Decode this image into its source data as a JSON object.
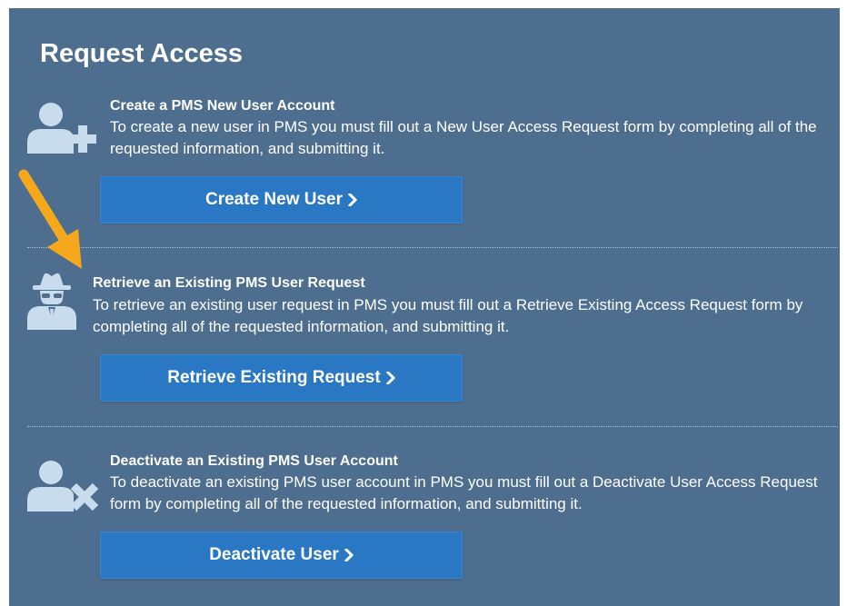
{
  "page": {
    "title": "Request Access"
  },
  "sections": [
    {
      "icon": "user-add-icon",
      "heading": "Create a PMS New User Account",
      "description": "To create a new user in PMS you must fill out a New User Access Request form by completing all of the requested information, and submitting it.",
      "button_label": "Create New User"
    },
    {
      "icon": "spy-user-icon",
      "heading": "Retrieve an Existing PMS User Request",
      "description": "To retrieve an existing user request in PMS you must fill out a Retrieve Existing Access Request form by completing all of the requested information, and submitting it.",
      "button_label": "Retrieve Existing Request"
    },
    {
      "icon": "user-remove-icon",
      "heading": "Deactivate an Existing PMS User Account",
      "description": "To deactivate an existing PMS user account in PMS you must fill out a Deactivate User Access Request form by completing all of the requested information, and submitting it.",
      "button_label": "Deactivate User"
    }
  ],
  "annotation": {
    "icon": "pointer-arrow-icon",
    "color": "#f5a81c"
  },
  "colors": {
    "panel_background": "#4d6e8f",
    "button_background": "#2a77c3",
    "icon_color": "#c9dcee"
  }
}
